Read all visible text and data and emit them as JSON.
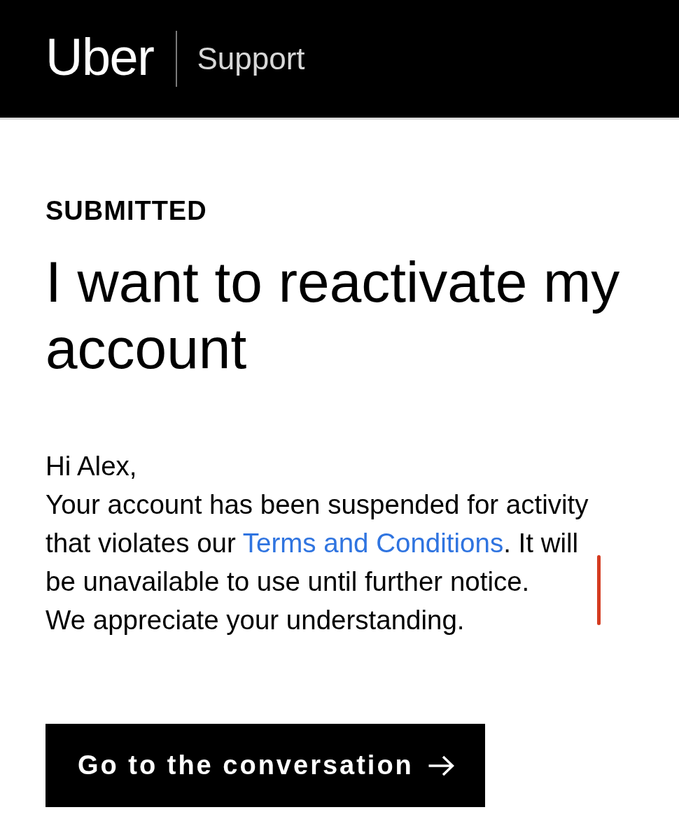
{
  "header": {
    "logo": "Uber",
    "section": "Support"
  },
  "request": {
    "status": "SUBMITTED",
    "title": "I want to reactivate my account"
  },
  "message": {
    "greeting": "Hi Alex,",
    "body": [
      {
        "kind": "text",
        "text": "Your account has been suspended for activity that violates our "
      },
      {
        "kind": "link",
        "text": "Terms and Conditions"
      },
      {
        "kind": "text",
        "text": ". It will be unavailable to use until further notice."
      }
    ],
    "closing": "We appreciate your understanding."
  },
  "action": {
    "label": "Go to the conversation"
  }
}
